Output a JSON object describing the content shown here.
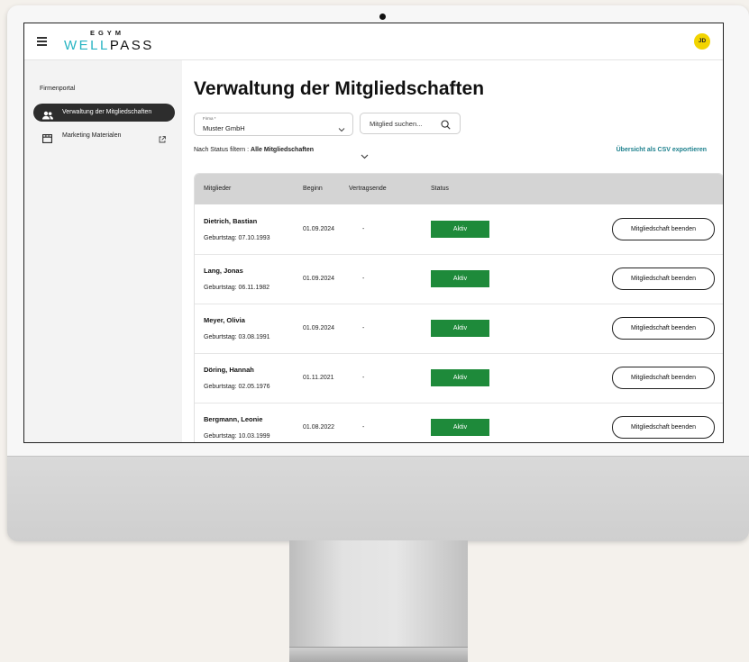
{
  "brand": {
    "logo_top": "EGYM",
    "logo_well": "WELL",
    "logo_pass": "PASS"
  },
  "user": {
    "initials": "JD"
  },
  "sidebar": {
    "heading": "Firmenportal",
    "items": [
      {
        "label": "Verwaltung der Mitgliedschaften",
        "icon": "users-icon",
        "active": true
      },
      {
        "label": "Marketing Materialen",
        "icon": "store-icon",
        "external": true
      }
    ]
  },
  "main": {
    "title": "Verwaltung der Mitgliedschaften",
    "firma": {
      "label": "Firma *",
      "value": "Muster GmbH"
    },
    "search": {
      "placeholder": "Mitglied suchen..."
    },
    "filter": {
      "prefix": "Nach Status filtern : ",
      "value": "Alle Mitgliedschaften"
    },
    "export_label": "Übersicht als CSV exportieren"
  },
  "table": {
    "headers": [
      "Mitglieder",
      "Beginn",
      "Vertragsende",
      "Status"
    ],
    "rows": [
      {
        "name": "Dietrich, Bastian",
        "birthday": "Geburtstag: 07.10.1993",
        "begin": "01.09.2024",
        "end": "-",
        "status": "Aktiv",
        "action": "Mitgliedschaft beenden"
      },
      {
        "name": "Lang, Jonas",
        "birthday": "Geburtstag: 06.11.1982",
        "begin": "01.09.2024",
        "end": "-",
        "status": "Aktiv",
        "action": "Mitgliedschaft beenden"
      },
      {
        "name": "Meyer, Olivia",
        "birthday": "Geburtstag: 03.08.1991",
        "begin": "01.09.2024",
        "end": "-",
        "status": "Aktiv",
        "action": "Mitgliedschaft beenden"
      },
      {
        "name": "Döring, Hannah",
        "birthday": "Geburtstag: 02.05.1976",
        "begin": "01.11.2021",
        "end": "-",
        "status": "Aktiv",
        "action": "Mitgliedschaft beenden"
      },
      {
        "name": "Bergmann, Leonie",
        "birthday": "Geburtstag: 10.03.1999",
        "begin": "01.08.2022",
        "end": "-",
        "status": "Aktiv",
        "action": "Mitgliedschaft beenden"
      }
    ]
  },
  "colors": {
    "accent": "#27b4c2",
    "active_status": "#1e8a3a",
    "export_link": "#1b7f8c",
    "avatar": "#f2d400"
  }
}
